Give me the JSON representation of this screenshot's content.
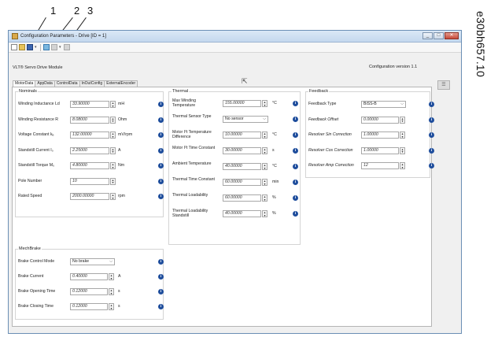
{
  "callouts": [
    "1",
    "2",
    "3"
  ],
  "figure_code": "e30bh657.10",
  "window": {
    "title": "Configuration Parameters - Drive [ID = 1]",
    "buttons": [
      "_",
      "□",
      "✕"
    ]
  },
  "module_name": "VLT® Servo Drive Module",
  "config_version": "Configuration version 1.1",
  "tabs": [
    "MotorData",
    "AppData",
    "ControlData",
    "InOutConfig",
    "ExternalEncoder"
  ],
  "nominals": {
    "title": "Nominals",
    "rows": [
      {
        "label": "Winding Inductance Ld",
        "value": "33.90000",
        "unit": "mH"
      },
      {
        "label": "Winding Resistance R",
        "value": "8.08000",
        "unit": "Ohm"
      },
      {
        "label": "Voltage Constant kₑ",
        "value": "132.00000",
        "unit": "mV/rpm"
      },
      {
        "label": "Standstill Current I₀",
        "value": "2.25000",
        "unit": "A"
      },
      {
        "label": "Standstill Torque M₀",
        "value": "4.80000",
        "unit": "Nm"
      },
      {
        "label": "Pole Number",
        "value": "10",
        "unit": ""
      },
      {
        "label": "Rated Speed",
        "value": "2000.00000",
        "unit": "rpm"
      }
    ]
  },
  "thermal": {
    "title": "Thermal",
    "rows": [
      {
        "label": "Max Winding Temperature",
        "value": "155.00000",
        "unit": "°C",
        "kind": "num"
      },
      {
        "label": "Thermal Sensor Type",
        "value": "No sensor",
        "unit": "",
        "kind": "select"
      },
      {
        "label": "Motor I²t Temperature Difference",
        "value": "10.00000",
        "unit": "°C",
        "kind": "num"
      },
      {
        "label": "Motor I²t Time Constant",
        "value": "30.00000",
        "unit": "s",
        "kind": "num"
      },
      {
        "label": "Ambient Temperature",
        "value": "40.00000",
        "unit": "°C",
        "kind": "num"
      },
      {
        "label": "Thermal Time Constant",
        "value": "60.00000",
        "unit": "min",
        "kind": "num"
      },
      {
        "label": "Thermal Loadability",
        "value": "60.00000",
        "unit": "%",
        "kind": "num"
      },
      {
        "label": "Thermal Loadability Standstill",
        "value": "40.00000",
        "unit": "%",
        "kind": "num"
      }
    ]
  },
  "feedback": {
    "title": "Feedback",
    "rows": [
      {
        "label": "Feedback Type",
        "value": "BiSS-B",
        "kind": "select"
      },
      {
        "label": "Feedback Offset",
        "value": "0.00000",
        "kind": "num"
      },
      {
        "label": "Resolver Sin Correction",
        "value": "1.00000",
        "kind": "num"
      },
      {
        "label": "Resolver Cos Correction",
        "value": "1.00000",
        "kind": "num"
      },
      {
        "label": "Resolver Amp Correction",
        "value": "12",
        "kind": "num"
      }
    ]
  },
  "mechbrake": {
    "title": "MechBrake",
    "rows": [
      {
        "label": "Brake Control Mode",
        "value": "No brake",
        "unit": "",
        "kind": "select"
      },
      {
        "label": "Brake Current",
        "value": "0.40000",
        "unit": "A",
        "kind": "num"
      },
      {
        "label": "Brake Opening Time",
        "value": "0.12000",
        "unit": "s",
        "kind": "num"
      },
      {
        "label": "Brake Closing Time",
        "value": "0.12000",
        "unit": "s",
        "kind": "num"
      }
    ]
  },
  "icons": {
    "info": "info-icon",
    "spin": "spinner-arrows-icon",
    "dropdown": "chevron-down-icon"
  }
}
